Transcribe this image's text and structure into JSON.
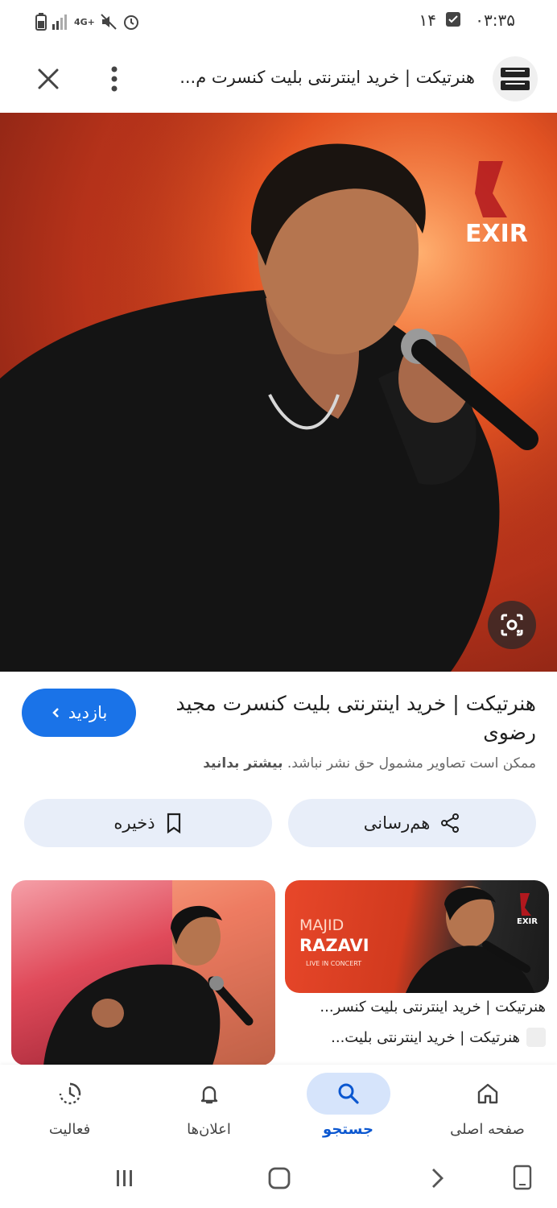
{
  "status_bar": {
    "time": "۰۳:۳۵",
    "date_badge": "۱۴",
    "network": "4G+"
  },
  "header": {
    "title": "هنرتیکت | خرید اینترنتی بلیت کنسرت م...",
    "logo_text": "هنر تیکت"
  },
  "main_image": {
    "watermark": "EXIR"
  },
  "result": {
    "title": "هنرتیکت | خرید اینترنتی بلیت کنسرت مجید رضوی",
    "visit_label": "بازدید",
    "copyright_text": "ممکن است تصاویر مشمول حق نشر نباشد.",
    "learn_more": "بیشتر بدانید"
  },
  "actions": {
    "share_label": "هم‌رسانی",
    "save_label": "ذخیره"
  },
  "related": [
    {
      "caption": "هنرتیکت | خرید اینترنتی بلیت کنسر...",
      "source": "هنرتیکت | خرید اینترنتی بلیت...",
      "image_text_line1": "MAJID",
      "image_text_line2": "RAZAVI",
      "image_text_line3": "LIVE IN CONCERT",
      "watermark": "EXIR"
    },
    {
      "caption": "",
      "source": ""
    }
  ],
  "bottom_nav": {
    "items": [
      {
        "label": "صفحه اصلی",
        "icon": "home-icon"
      },
      {
        "label": "جستجو",
        "icon": "search-icon"
      },
      {
        "label": "اعلان‌ها",
        "icon": "bell-icon"
      },
      {
        "label": "فعالیت",
        "icon": "activity-icon"
      }
    ],
    "active": "جستجو"
  },
  "colors": {
    "accent": "#1a73e8",
    "pill_bg": "#e8eef9",
    "active_nav_bg": "#d6e4fb"
  }
}
